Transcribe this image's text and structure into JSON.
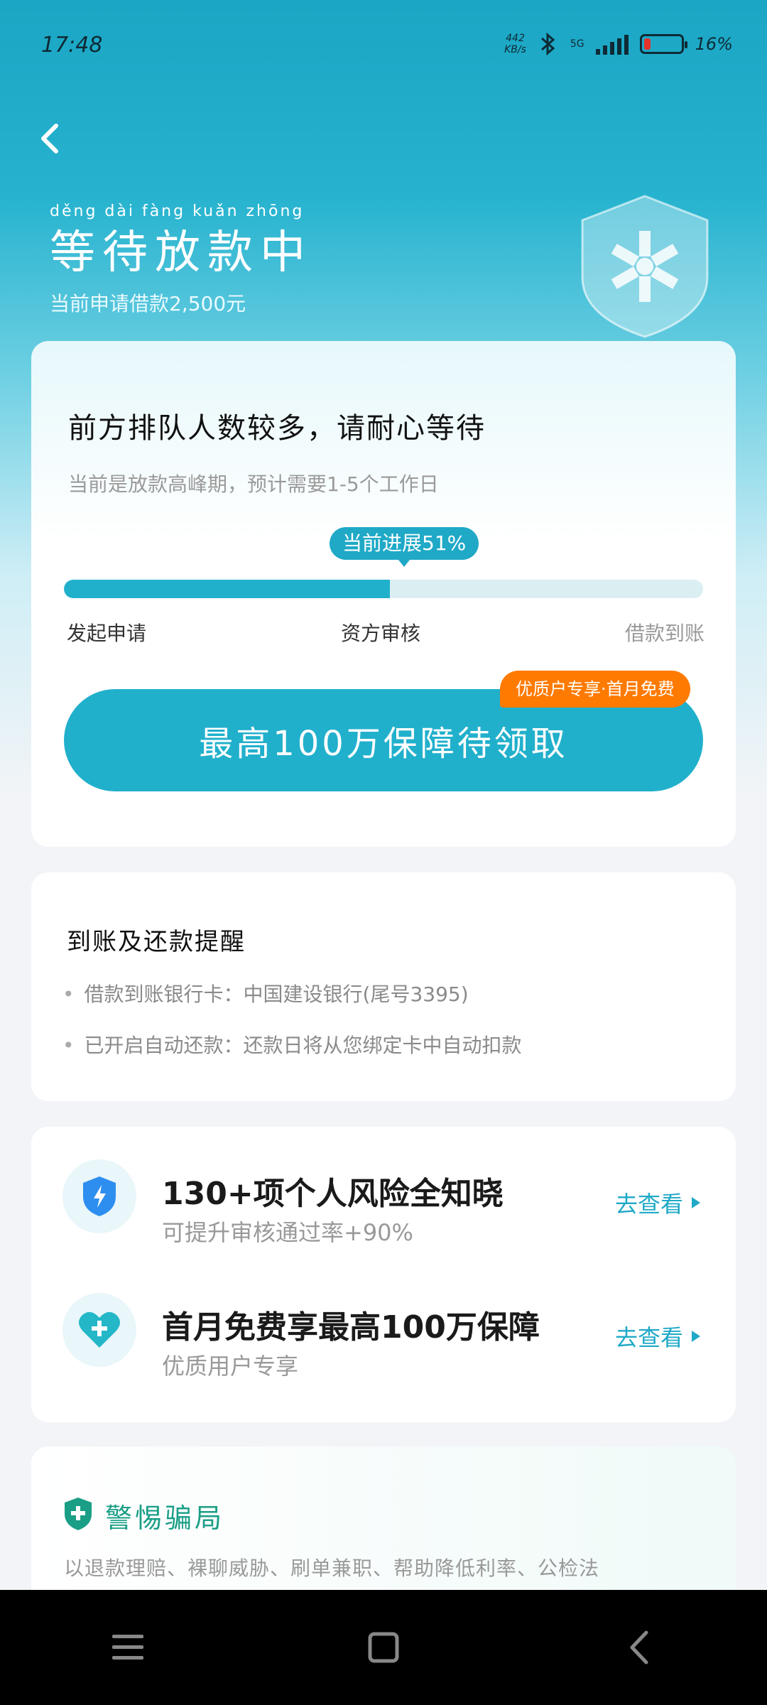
{
  "status_bar": {
    "time": "17:48",
    "net_speed_value": "442",
    "net_speed_unit": "KB/s",
    "network": "5G",
    "battery_text": "16%",
    "battery_level": 0.16
  },
  "header": {
    "pinyin": "děng dài fàng kuǎn zhōng",
    "title": "等待放款中",
    "subtitle": "当前申请借款2,500元"
  },
  "progress_card": {
    "heading": "前方排队人数较多，请耐心等待",
    "note": "当前是放款高峰期，预计需要1-5个工作日",
    "badge": "当前进展51%",
    "progress_percent": 51,
    "stages": [
      "发起申请",
      "资方审核",
      "借款到账"
    ],
    "claim_button": "最高100万保障待领取",
    "promo_tag": "优质户专享·首月免费"
  },
  "remind_card": {
    "title": "到账及还款提醒",
    "items": [
      "借款到账银行卡：中国建设银行(尾号3395)",
      "已开启自动还款：还款日将从您绑定卡中自动扣款"
    ]
  },
  "services": [
    {
      "title": "130+项个人风险全知晓",
      "subtitle": "可提升审核通过率+90%",
      "link": "去查看",
      "icon": "shield-bolt-icon"
    },
    {
      "title": "首月免费享最高100万保障",
      "subtitle": "优质用户专享",
      "link": "去查看",
      "icon": "heart-plus-icon"
    }
  ],
  "fraud_card": {
    "title": "警惕骗局",
    "text": "以退款理赔、裸聊威胁、刷单兼职、帮助降低利率、公检法"
  },
  "colors": {
    "accent": "#1fa9c7",
    "promo": "#ff7a00",
    "fraud_green": "#1a9e86"
  }
}
